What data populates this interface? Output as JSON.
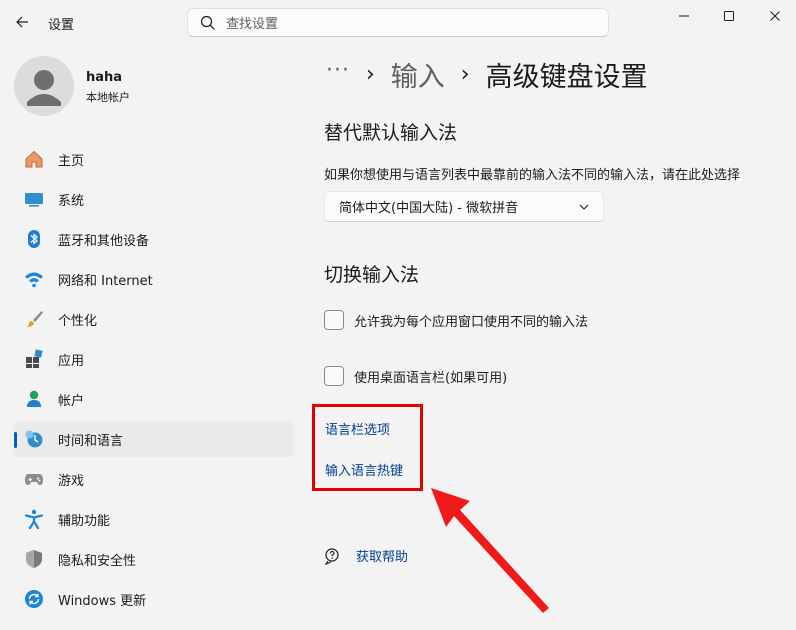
{
  "window": {
    "title": "设置",
    "back_icon": "back-arrow-icon",
    "controls": [
      "minimize-icon",
      "maximize-icon",
      "close-icon"
    ]
  },
  "search": {
    "placeholder": "查找设置",
    "icon": "search-icon"
  },
  "profile": {
    "name": "haha",
    "account_type": "本地帐户"
  },
  "sidebar": {
    "items": [
      {
        "label": "主页",
        "icon": "home-icon"
      },
      {
        "label": "系统",
        "icon": "display-icon"
      },
      {
        "label": "蓝牙和其他设备",
        "icon": "bluetooth-icon"
      },
      {
        "label": "网络和 Internet",
        "icon": "wifi-icon"
      },
      {
        "label": "个性化",
        "icon": "brush-icon"
      },
      {
        "label": "应用",
        "icon": "apps-icon"
      },
      {
        "label": "帐户",
        "icon": "account-icon"
      },
      {
        "label": "时间和语言",
        "icon": "time-language-icon",
        "active": true
      },
      {
        "label": "游戏",
        "icon": "gamepad-icon"
      },
      {
        "label": "辅助功能",
        "icon": "accessibility-icon"
      },
      {
        "label": "隐私和安全性",
        "icon": "shield-icon"
      },
      {
        "label": "Windows 更新",
        "icon": "update-icon"
      }
    ]
  },
  "breadcrumb": {
    "more": "···",
    "parent": "输入",
    "current": "高级键盘设置"
  },
  "override_section": {
    "heading": "替代默认输入法",
    "description": "如果你想使用与语言列表中最靠前的输入法不同的输入法，请在此处选择",
    "selected_value": "简体中文(中国大陆) - 微软拼音"
  },
  "switch_section": {
    "heading": "切换输入法",
    "checkbox_per_app": "允许我为每个应用窗口使用不同的输入法",
    "checkbox_desktop_bar": "使用桌面语言栏(如果可用)",
    "per_app_checked": false,
    "desktop_bar_checked": false
  },
  "links": {
    "language_bar_options": "语言栏选项",
    "input_language_hotkeys": "输入语言热键"
  },
  "help": {
    "label": "获取帮助",
    "icon": "help-icon"
  },
  "colors": {
    "accent": "#005fb8",
    "link": "#003e92",
    "annotation": "#e30000"
  }
}
